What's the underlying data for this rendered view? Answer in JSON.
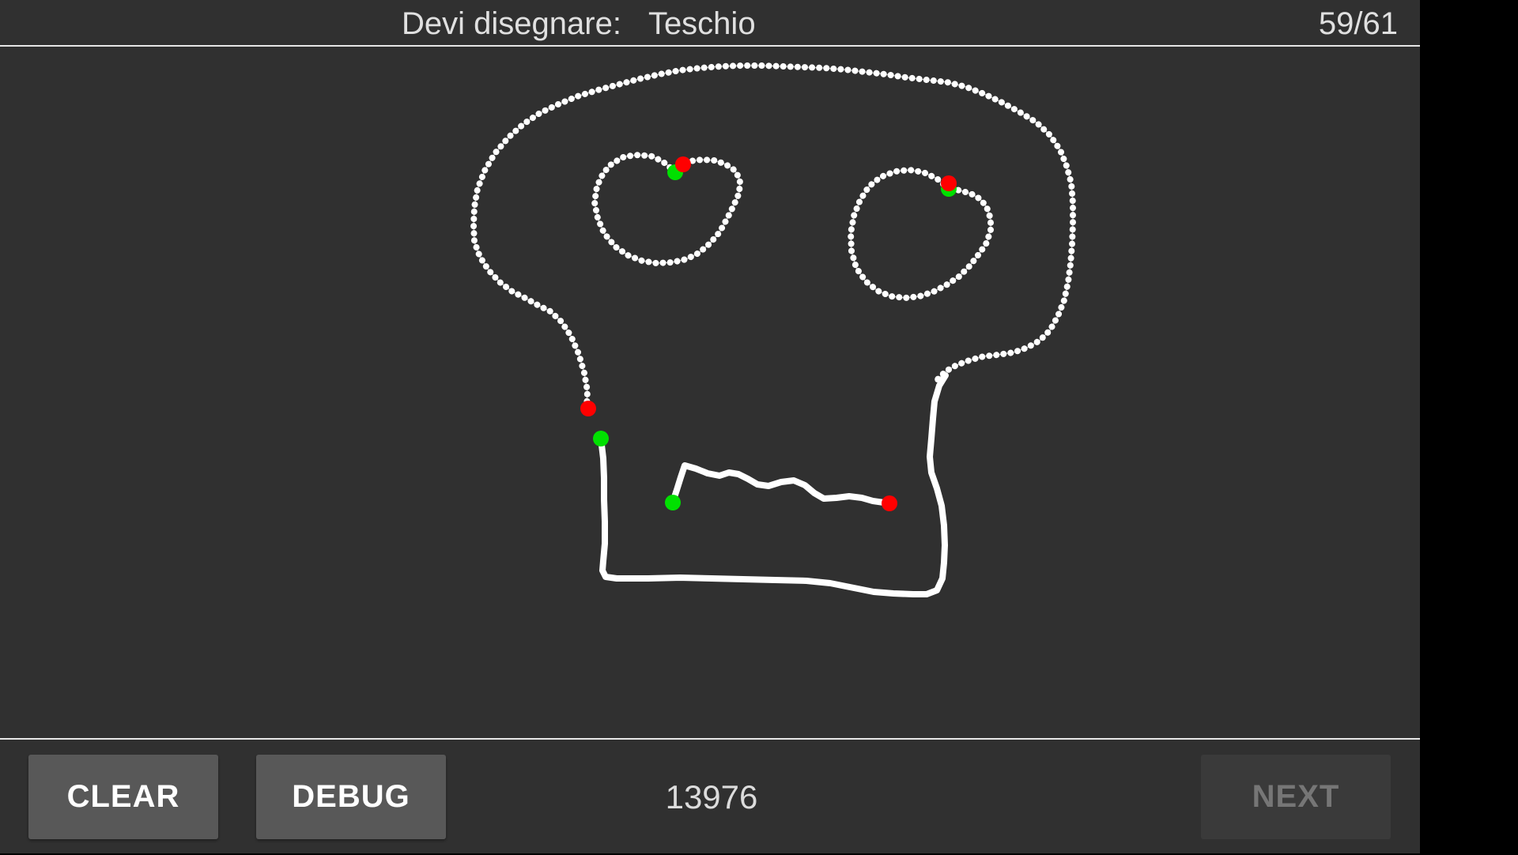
{
  "header": {
    "prompt_label": "Devi disegnare:",
    "target_word": "Teschio",
    "progress": "59/61"
  },
  "canvas": {
    "stroke_color": "#ffffff",
    "start_marker_color": "#00e000",
    "end_marker_color": "#ff0000",
    "background": "#303030"
  },
  "footer": {
    "clear_label": "CLEAR",
    "debug_label": "DEBUG",
    "score": "13976",
    "next_label": "NEXT",
    "next_enabled": false
  }
}
